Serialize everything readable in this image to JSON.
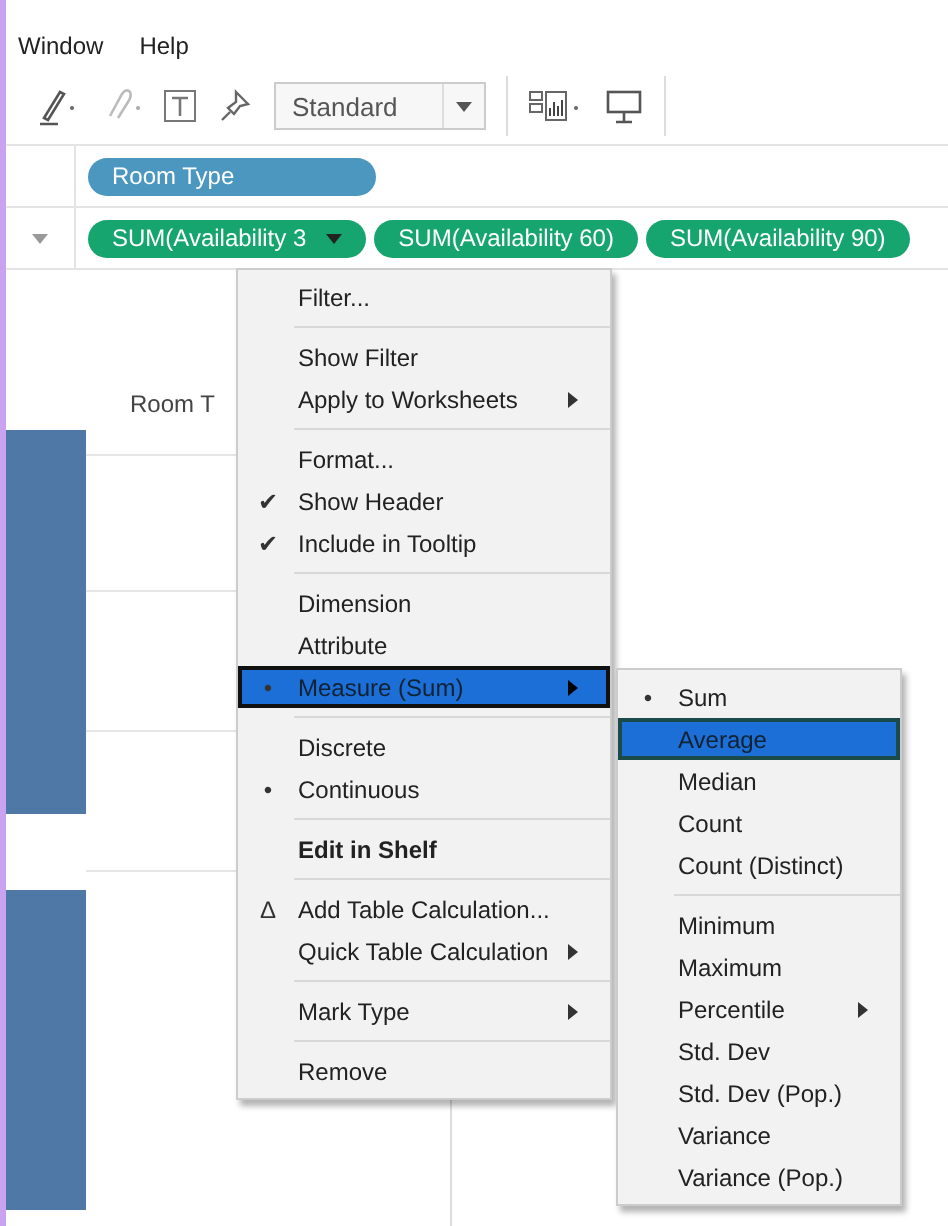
{
  "menubar": [
    "Window",
    "Help"
  ],
  "toolbar": {
    "view_select": "Standard"
  },
  "rows_shelf": {
    "pills": [
      {
        "label": "Room Type",
        "kind": "dimension"
      }
    ]
  },
  "columns_shelf": {
    "pills": [
      {
        "label": "SUM(Availability 3",
        "kind": "measure"
      },
      {
        "label": "SUM(Availability 60)",
        "kind": "measure"
      },
      {
        "label": "SUM(Availability 90)",
        "kind": "measure"
      }
    ]
  },
  "canvas": {
    "header": "Room T"
  },
  "context_menu": {
    "groups": [
      [
        {
          "label": "Filter...",
          "submenu": false,
          "selected": false
        }
      ],
      [
        {
          "label": "Show Filter",
          "submenu": false,
          "selected": false
        },
        {
          "label": "Apply to Worksheets",
          "submenu": true,
          "selected": false
        }
      ],
      [
        {
          "label": "Format...",
          "submenu": false,
          "selected": false
        },
        {
          "label": "Show Header",
          "mark": "✔",
          "submenu": false,
          "selected": false
        },
        {
          "label": "Include in Tooltip",
          "mark": "✔",
          "submenu": false,
          "selected": false
        }
      ],
      [
        {
          "label": "Dimension",
          "submenu": false,
          "selected": false
        },
        {
          "label": "Attribute",
          "submenu": false,
          "selected": false
        },
        {
          "label": "Measure (Sum)",
          "mark": "•",
          "submenu": true,
          "selected": true
        }
      ],
      [
        {
          "label": "Discrete",
          "submenu": false,
          "selected": false
        },
        {
          "label": "Continuous",
          "mark": "•",
          "submenu": false,
          "selected": false
        }
      ],
      [
        {
          "label": "Edit in Shelf",
          "bold": true,
          "submenu": false,
          "selected": false
        }
      ],
      [
        {
          "label": "Add Table Calculation...",
          "mark": "Δ",
          "submenu": false,
          "selected": false
        },
        {
          "label": "Quick Table Calculation",
          "submenu": true,
          "selected": false
        }
      ],
      [
        {
          "label": "Mark Type",
          "submenu": true,
          "selected": false
        }
      ],
      [
        {
          "label": "Remove",
          "submenu": false,
          "selected": false
        }
      ]
    ]
  },
  "submenu": {
    "groups": [
      [
        {
          "label": "Sum",
          "mark": "•",
          "submenu": false,
          "selected": false
        },
        {
          "label": "Average",
          "submenu": false,
          "selected": true
        },
        {
          "label": "Median",
          "submenu": false,
          "selected": false
        },
        {
          "label": "Count",
          "submenu": false,
          "selected": false
        },
        {
          "label": "Count (Distinct)",
          "submenu": false,
          "selected": false
        }
      ],
      [
        {
          "label": "Minimum",
          "submenu": false,
          "selected": false
        },
        {
          "label": "Maximum",
          "submenu": false,
          "selected": false
        },
        {
          "label": "Percentile",
          "submenu": true,
          "selected": false
        },
        {
          "label": "Std. Dev",
          "submenu": false,
          "selected": false
        },
        {
          "label": "Std. Dev (Pop.)",
          "submenu": false,
          "selected": false
        },
        {
          "label": "Variance",
          "submenu": false,
          "selected": false
        },
        {
          "label": "Variance (Pop.)",
          "submenu": false,
          "selected": false
        }
      ]
    ]
  }
}
